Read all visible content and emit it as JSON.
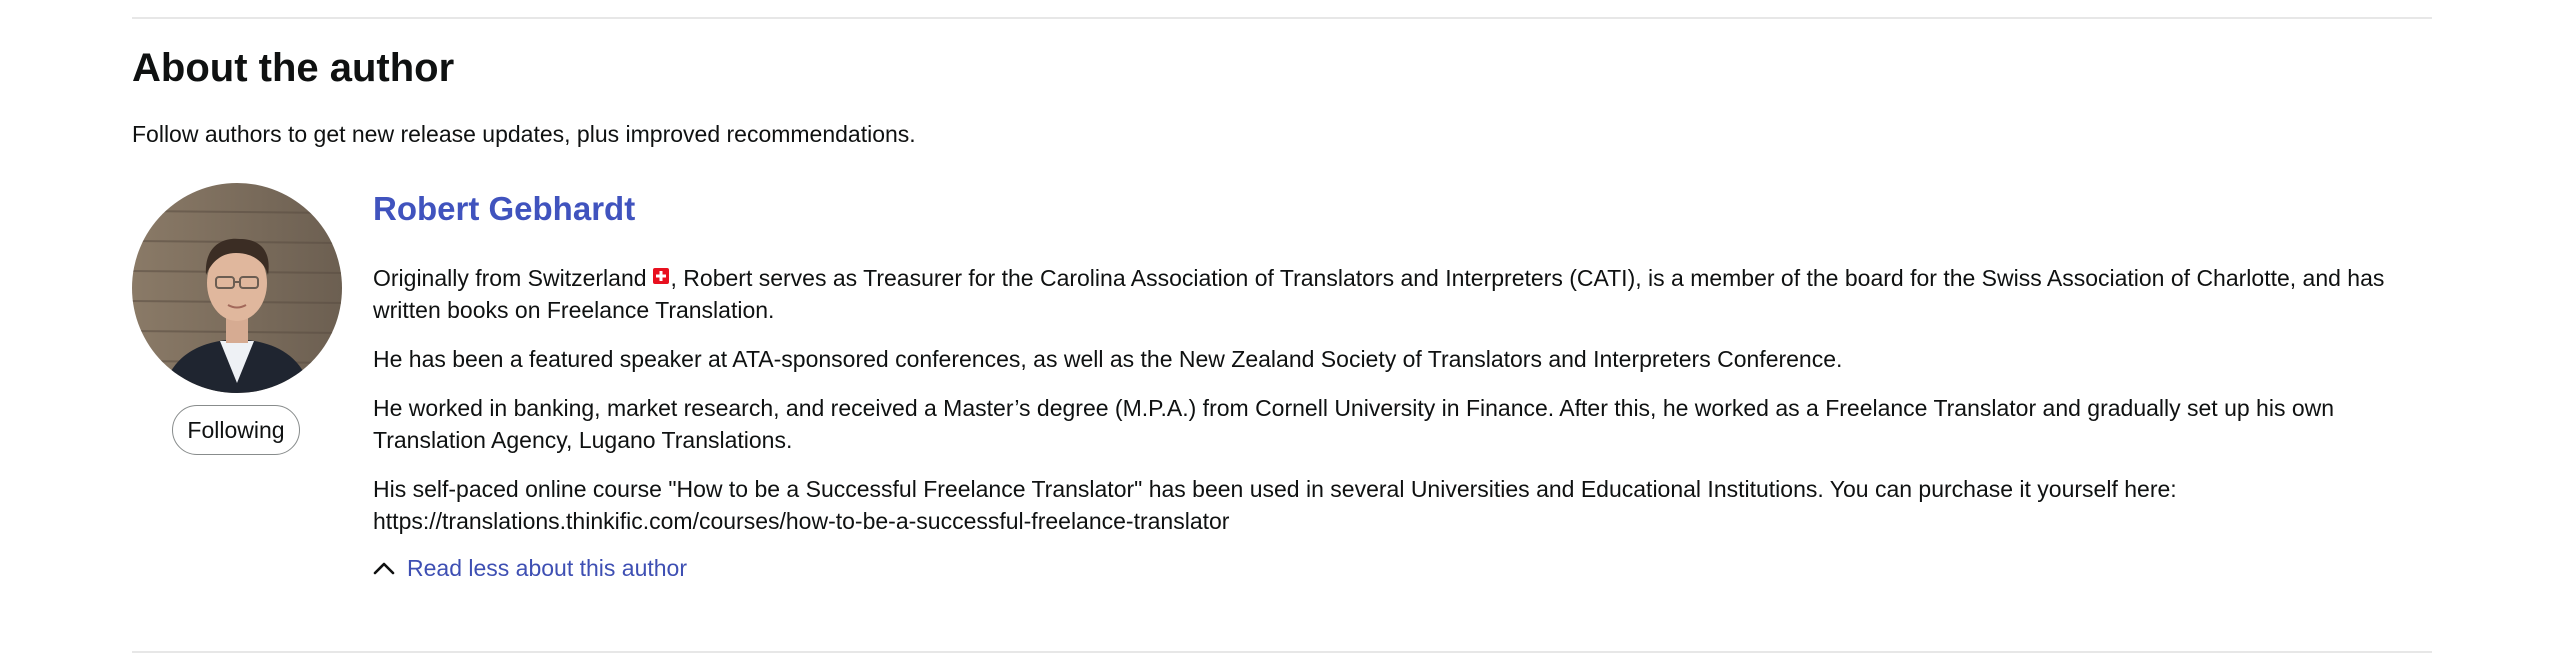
{
  "section": {
    "title": "About the author",
    "subtitle": "Follow authors to get new release updates, plus improved recommendations."
  },
  "author": {
    "name": "Robert Gebhardt",
    "follow_label": "Following",
    "avatar_icon": "author-photo",
    "flag_icon": "swiss-flag-icon",
    "bio": {
      "p1_before_flag": "Originally from Switzerland",
      "p1_after_flag": ", Robert serves as Treasurer for the Carolina Association of Translators and Interpreters (CATI), is a member of the board for the Swiss Association of Charlotte, and has written books on Freelance Translation.",
      "p2": "He has been a featured speaker at ATA-sponsored conferences, as well as the New Zealand Society of Translators and Interpreters Conference.",
      "p3": "He worked in banking, market research, and received a Master’s degree (M.P.A.) from Cornell University in Finance. After this, he worked as a Freelance Translator and gradually set up his own Translation Agency, Lugano Translations.",
      "p4_line1": "His self-paced online course \"How to be a Successful Freelance Translator\" has been used in several Universities and Educational Institutions. You can purchase it yourself here:",
      "p4_line2": "https://translations.thinkific.com/courses/how-to-be-a-successful-freelance-translator"
    },
    "read_less_label": "Read less about this author"
  },
  "colors": {
    "link": "#4053be",
    "text": "#0f1111",
    "divider": "#e7e7e7",
    "button_border": "#888c8c",
    "flag_red": "#e8101f"
  }
}
